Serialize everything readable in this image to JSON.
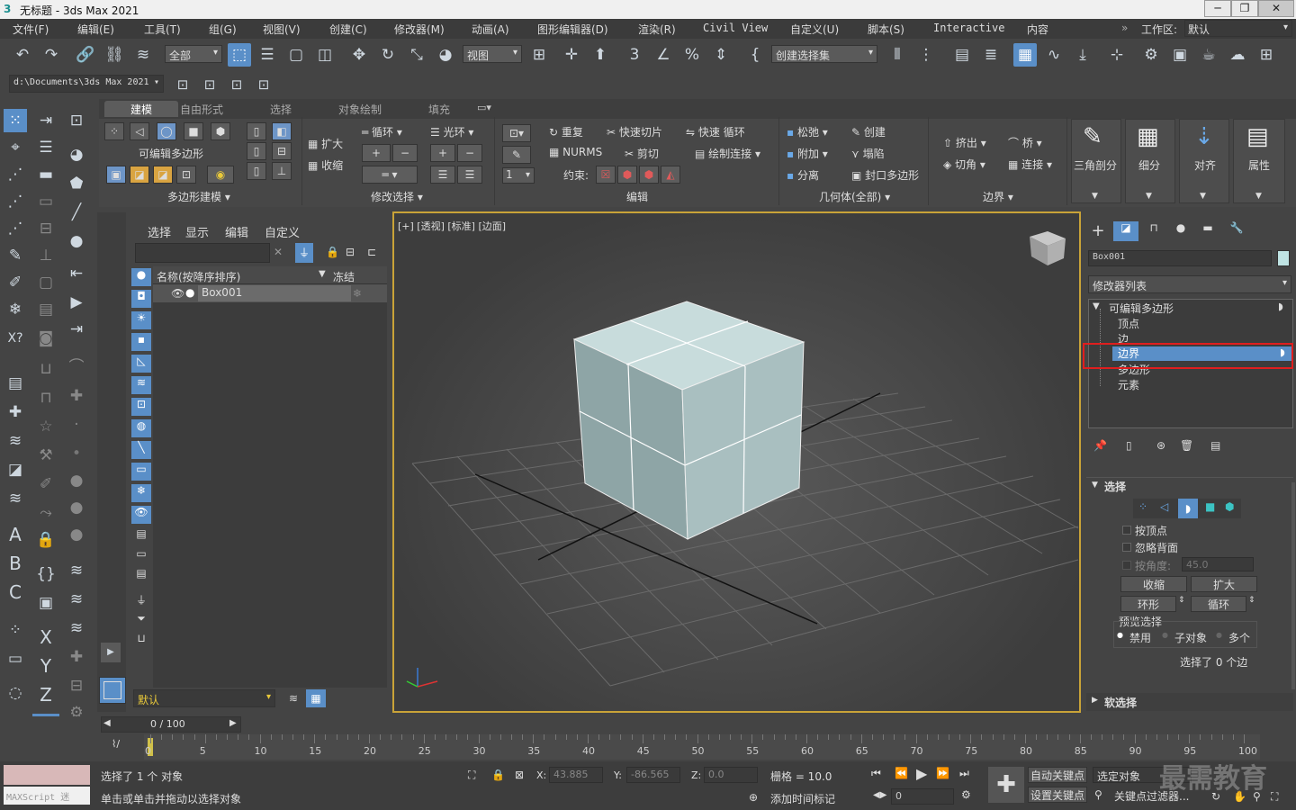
{
  "window": {
    "title": "无标题 - 3ds Max 2021",
    "app_icon": "3ds-max-logo-icon"
  },
  "menu": [
    "文件(F)",
    "编辑(E)",
    "工具(T)",
    "组(G)",
    "视图(V)",
    "创建(C)",
    "修改器(M)",
    "动画(A)",
    "图形编辑器(D)",
    "渲染(R)",
    "Civil View",
    "自定义(U)",
    "脚本(S)",
    "Interactive",
    "内容"
  ],
  "workspace": {
    "label": "工作区:",
    "value": "默认"
  },
  "toolbar": {
    "filter_value": "全部",
    "refcoord_value": "视图",
    "selset_placeholder": "创建选择集"
  },
  "project_path": "d:\\Documents\\3ds Max 2021",
  "ribbon": {
    "tabs": [
      "建模",
      "自由形式",
      "选择",
      "对象绘制",
      "填充"
    ],
    "poly_label": "可编辑多边形",
    "polymodeling": "多边形建模 ▾",
    "modifysel": "修改选择 ▾",
    "edit": "编辑",
    "geometry": "几何体(全部) ▾",
    "border": "边界 ▾",
    "grow": "扩大",
    "shrink": "收缩",
    "loop": "循环",
    "ring": "光环",
    "repeat": "重复",
    "quickslice": "快速切片",
    "swiftloop": "快速 循环",
    "nurms": "NURMS",
    "cut": "剪切",
    "paintconnect": "绘制连接",
    "constrain": "约束:",
    "relax": "松弛",
    "create": "创建",
    "attach": "附加",
    "collapse": "塌陷",
    "detach": "分离",
    "cap": "封口多边形",
    "extrude": "挤出",
    "bridge": "桥",
    "chamfer": "切角",
    "connect": "连接",
    "triangulate": "三角剖分",
    "subdivide": "细分",
    "align": "对齐",
    "properties": "属性",
    "spin_value": "1"
  },
  "scene": {
    "tabs": [
      "选择",
      "显示",
      "编辑",
      "自定义"
    ],
    "col_name": "名称(按降序排序)",
    "col_freeze": "冻结",
    "object": "Box001",
    "layer": "默认"
  },
  "viewport": {
    "label": "[+] [透视] [标准] [边面]"
  },
  "cmd": {
    "objname": "Box001",
    "modlist": "修改器列表",
    "stack": {
      "root": "可编辑多边形",
      "items": [
        "顶点",
        "边",
        "边界",
        "多边形",
        "元素"
      ],
      "selected": "边界"
    },
    "rollout_sel": "选择",
    "byvertex": "按顶点",
    "ignoreback": "忽略背面",
    "byangle": "按角度:",
    "angle_value": "45.0",
    "shrink": "收缩",
    "grow": "扩大",
    "ring": "环形",
    "loop": "循环",
    "preview": "预览选择",
    "off": "禁用",
    "subobj": "子对象",
    "multi": "多个",
    "selcount": "选择了 0 个边",
    "softsel": "软选择"
  },
  "time": {
    "frame": "0 / 100",
    "ticks": [
      "0",
      "5",
      "10",
      "15",
      "20",
      "25",
      "30",
      "35",
      "40",
      "45",
      "50",
      "55",
      "60",
      "65",
      "70",
      "75",
      "80",
      "85",
      "90",
      "95",
      "100"
    ]
  },
  "status": {
    "maxscript": "MAXScript 迷",
    "selected": "选择了 1 个 对象",
    "hint": "单击或单击并拖动以选择对象",
    "x_label": "X:",
    "x": "43.885",
    "y_label": "Y:",
    "y": "-86.565",
    "z_label": "Z:",
    "z": "0.0",
    "grid": "栅格 = 10.0",
    "addtag": "添加时间标记",
    "autokey": "自动关键点",
    "setkey": "设置关键点",
    "selobj": "选定对象",
    "keyfilter": "关键点过滤器...",
    "frame_value": "0",
    "watermark": "最需教育"
  }
}
